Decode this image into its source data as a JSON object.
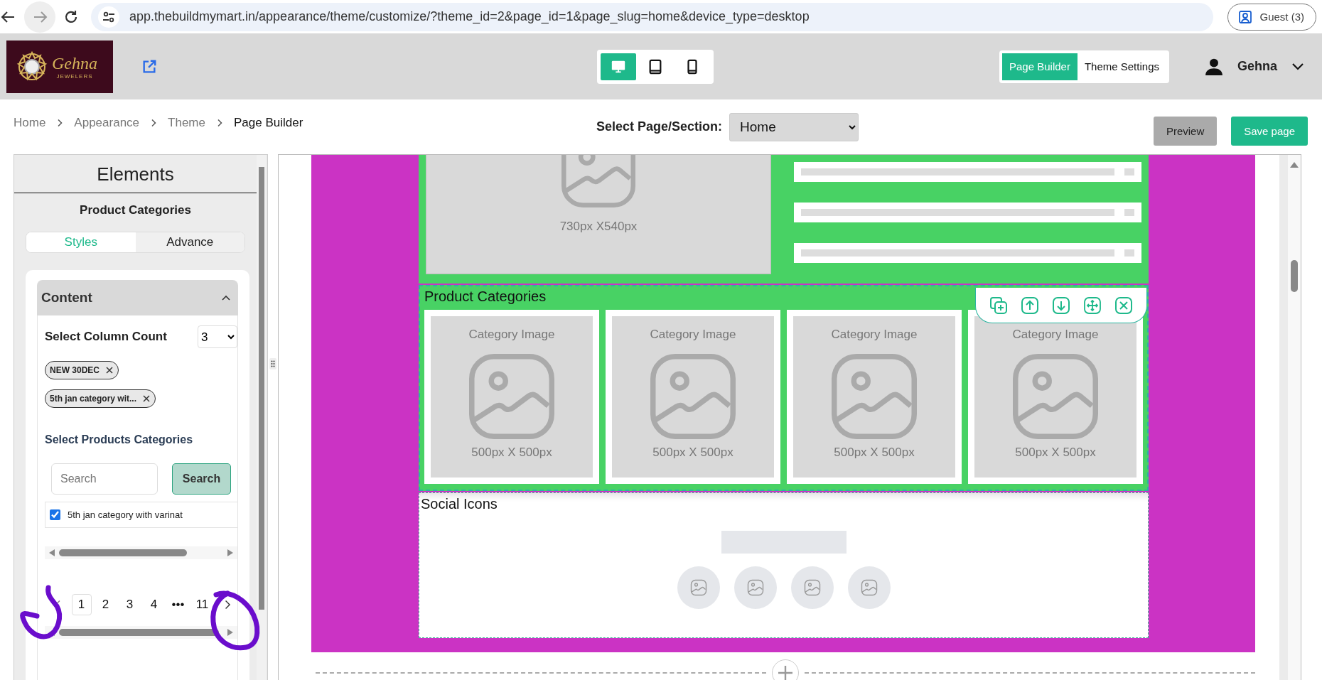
{
  "browser": {
    "url": "app.thebuildmymart.in/appearance/theme/customize/?theme_id=2&page_id=1&page_slug=home&device_type=desktop",
    "profile": "Guest (3)"
  },
  "header": {
    "logo": {
      "name": "Gehna",
      "tagline": "JEWELERS"
    },
    "devices": [
      {
        "kind": "desktop",
        "selected": true
      },
      {
        "kind": "tablet",
        "selected": false
      },
      {
        "kind": "mobile",
        "selected": false
      }
    ],
    "modes": [
      {
        "label": "Page Builder",
        "selected": true
      },
      {
        "label": "Theme Settings",
        "selected": false
      }
    ],
    "user": "Gehna"
  },
  "breadcrumb": [
    "Home",
    "Appearance",
    "Theme",
    "Page Builder"
  ],
  "page_select": {
    "label": "Select Page/Section:",
    "value": "Home"
  },
  "actions": [
    {
      "label": "Preview",
      "kind": "secondary"
    },
    {
      "label": "Save page",
      "kind": "primary"
    }
  ],
  "panel": {
    "title": "Elements",
    "subtitle": "Product Categories",
    "tabs": [
      {
        "label": "Styles",
        "selected": true
      },
      {
        "label": "Advance",
        "selected": false
      }
    ],
    "content": {
      "title": "Content",
      "expanded": true,
      "column_count": {
        "label": "Select Column Count",
        "value": "3"
      },
      "tags": [
        "NEW 30DEC",
        "5th jan category wit..."
      ],
      "categories_label": "Select Products Categories",
      "search": {
        "placeholder": "Search",
        "button": "Search"
      },
      "options": [
        {
          "label": "5th jan category with varinat",
          "checked": true
        }
      ],
      "pages": [
        {
          "label": "1",
          "selected": true
        },
        {
          "label": "2",
          "selected": false
        },
        {
          "label": "3",
          "selected": false
        },
        {
          "label": "4",
          "selected": false
        },
        {
          "label": "•••",
          "selected": false
        },
        {
          "label": "11",
          "selected": false
        }
      ]
    }
  },
  "canvas": {
    "hero": {
      "caption": "730px X540px"
    },
    "product_section": {
      "title": "Product Categories",
      "cards": [
        {
          "label": "Category Image",
          "size": "500px X 500px"
        },
        {
          "label": "Category Image",
          "size": "500px X 500px"
        },
        {
          "label": "Category Image",
          "size": "500px X 500px"
        },
        {
          "label": "Category Image",
          "size": "500px X 500px"
        }
      ]
    },
    "social_section": {
      "title": "Social Icons"
    }
  }
}
